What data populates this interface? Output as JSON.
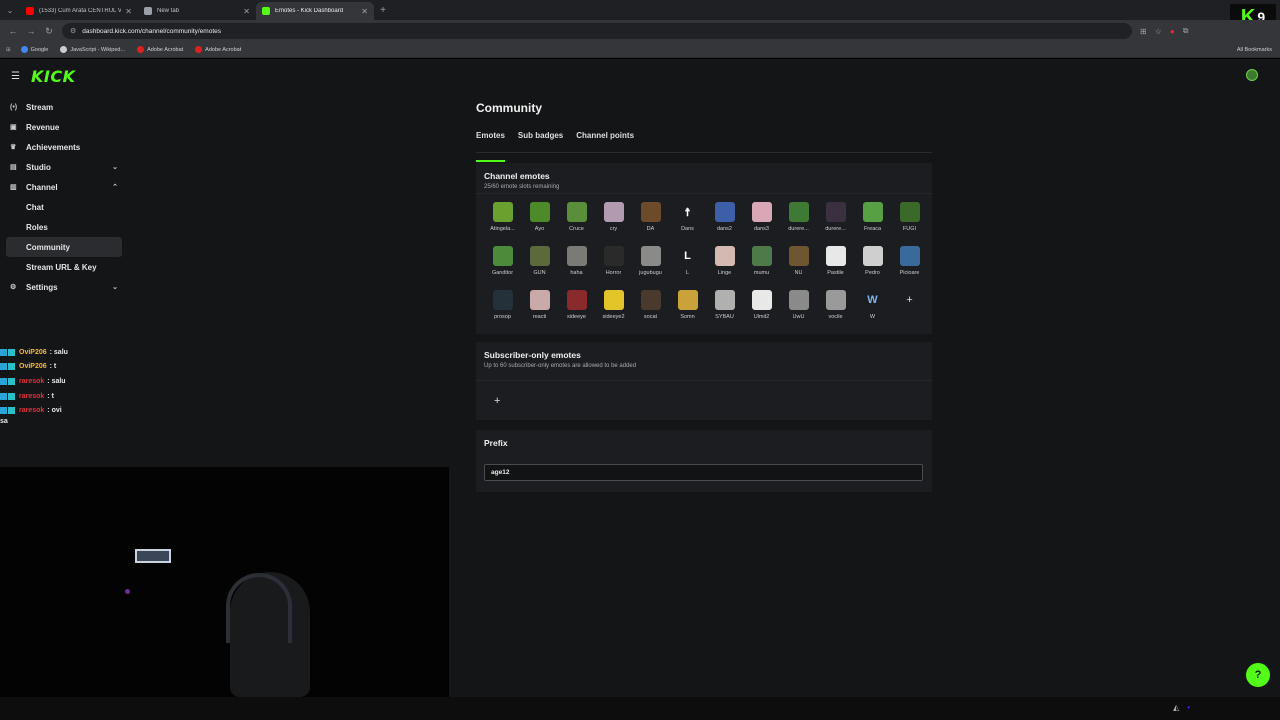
{
  "browser": {
    "tabs": [
      {
        "title": "(1533) Cum Arata CENTRUL VE",
        "favicon_color": "#ff0000",
        "active": false
      },
      {
        "title": "New tab",
        "favicon_color": "#9aa0a6",
        "active": false
      },
      {
        "title": "Emotes - Kick Dashboard",
        "favicon_color": "#53fc18",
        "active": true
      }
    ],
    "url": "dashboard.kick.com/channel/community/emotes",
    "bookmarks": [
      {
        "label": "Google",
        "color": "#4285f4"
      },
      {
        "label": "JavaScript - Wikiped...",
        "color": "#cccccc"
      },
      {
        "label": "Adobe Acrobat",
        "color": "#e02020"
      },
      {
        "label": "Adobe Acrobat",
        "color": "#e02020"
      }
    ],
    "all_bookmarks": "All Bookmarks",
    "overlay_badge": {
      "letter": "K",
      "number": "9"
    }
  },
  "app": {
    "logo": "KICK",
    "accent": "#53fc18"
  },
  "sidebar": {
    "items": [
      {
        "label": "Stream",
        "icon": "stream-icon",
        "glyph": "(•)",
        "sub": false,
        "active": false,
        "chevron": ""
      },
      {
        "label": "Revenue",
        "icon": "revenue-icon",
        "glyph": "▣",
        "sub": false,
        "active": false,
        "chevron": ""
      },
      {
        "label": "Achievements",
        "icon": "trophy-icon",
        "glyph": "♛",
        "sub": false,
        "active": false,
        "chevron": ""
      },
      {
        "label": "Studio",
        "icon": "studio-icon",
        "glyph": "▤",
        "sub": false,
        "active": false,
        "chevron": "⌄"
      },
      {
        "label": "Channel",
        "icon": "channel-icon",
        "glyph": "▥",
        "sub": false,
        "active": false,
        "chevron": "⌃"
      },
      {
        "label": "Chat",
        "icon": "",
        "glyph": "",
        "sub": true,
        "active": false,
        "chevron": ""
      },
      {
        "label": "Roles",
        "icon": "",
        "glyph": "",
        "sub": true,
        "active": false,
        "chevron": ""
      },
      {
        "label": "Community",
        "icon": "",
        "glyph": "",
        "sub": true,
        "active": true,
        "chevron": ""
      },
      {
        "label": "Stream URL & Key",
        "icon": "",
        "glyph": "",
        "sub": true,
        "active": false,
        "chevron": ""
      },
      {
        "label": "Settings",
        "icon": "gear-icon",
        "glyph": "⚙",
        "sub": false,
        "active": false,
        "chevron": "⌄"
      }
    ]
  },
  "chat_overlay": {
    "lines": [
      {
        "user": "OviP206",
        "color": "#f5b93a",
        "text": ": salu"
      },
      {
        "user": "OviP206",
        "color": "#f5b93a",
        "text": ": t"
      },
      {
        "user": "raresok",
        "color": "#e0323c",
        "text": ": salu"
      },
      {
        "user": "raresok",
        "color": "#e0323c",
        "text": ": t"
      },
      {
        "user": "raresok",
        "color": "#e0323c",
        "text": ": ovi"
      }
    ],
    "tail": "sa"
  },
  "community": {
    "title": "Community",
    "tabs": [
      {
        "label": "Emotes",
        "active": true
      },
      {
        "label": "Sub badges",
        "active": false
      },
      {
        "label": "Channel points",
        "active": false
      }
    ],
    "channel_emotes": {
      "title": "Channel emotes",
      "subtitle": "25/60 emote slots remaining",
      "emotes": [
        {
          "name": "Atingela...",
          "color": "#6aa12e",
          "glyph": ""
        },
        {
          "name": "Ayo",
          "color": "#4c8a2c",
          "glyph": ""
        },
        {
          "name": "Cruce",
          "color": "#5a8f3a",
          "glyph": ""
        },
        {
          "name": "cry",
          "color": "#b29ab0",
          "glyph": ""
        },
        {
          "name": "DA",
          "color": "#6d4a2a",
          "glyph": ""
        },
        {
          "name": "Dans",
          "color": "#1c1d20",
          "glyph": "☨"
        },
        {
          "name": "dans2",
          "color": "#3d5ea8",
          "glyph": ""
        },
        {
          "name": "dans3",
          "color": "#d9a7b6",
          "glyph": ""
        },
        {
          "name": "durere...",
          "color": "#3f7a35",
          "glyph": ""
        },
        {
          "name": "durere...",
          "color": "#3a3040",
          "glyph": ""
        },
        {
          "name": "Freaca",
          "color": "#57a043",
          "glyph": ""
        },
        {
          "name": "FUGI",
          "color": "#3a6a2a",
          "glyph": ""
        },
        {
          "name": "Ganditor",
          "color": "#4b8b3a",
          "glyph": ""
        },
        {
          "name": "GUN",
          "color": "#5b6a3a",
          "glyph": ""
        },
        {
          "name": "haha",
          "color": "#7a7a76",
          "glyph": ""
        },
        {
          "name": "Horror",
          "color": "#2a2a2a",
          "glyph": ""
        },
        {
          "name": "jugubugu",
          "color": "#8a8a88",
          "glyph": ""
        },
        {
          "name": "L",
          "color": "#1c1d20",
          "glyph": "L"
        },
        {
          "name": "Linge",
          "color": "#d4b8b2",
          "glyph": ""
        },
        {
          "name": "mumu",
          "color": "#4e7a4a",
          "glyph": ""
        },
        {
          "name": "NU",
          "color": "#6e5630",
          "glyph": ""
        },
        {
          "name": "Pastile",
          "color": "#e8e8e8",
          "glyph": ""
        },
        {
          "name": "Pedro",
          "color": "#cfcfcf",
          "glyph": ""
        },
        {
          "name": "Picioare",
          "color": "#3a6a9a",
          "glyph": ""
        },
        {
          "name": "prosop",
          "color": "#24313a",
          "glyph": ""
        },
        {
          "name": "reacti",
          "color": "#c9aaa8",
          "glyph": ""
        },
        {
          "name": "sideeye",
          "color": "#8a2a2a",
          "glyph": ""
        },
        {
          "name": "sideeye2",
          "color": "#e3c52a",
          "glyph": ""
        },
        {
          "name": "socat",
          "color": "#4a3a2e",
          "glyph": ""
        },
        {
          "name": "Somn",
          "color": "#c9a23a",
          "glyph": ""
        },
        {
          "name": "SYBAU",
          "color": "#b0b0b0",
          "glyph": ""
        },
        {
          "name": "Ulmit2",
          "color": "#e8e8e8",
          "glyph": ""
        },
        {
          "name": "UwU",
          "color": "#8a8a8a",
          "glyph": ""
        },
        {
          "name": "vocile",
          "color": "#9a9a9a",
          "glyph": ""
        },
        {
          "name": "W",
          "color": "#1c1d20",
          "glyph": "W"
        }
      ],
      "add_glyph": "+"
    },
    "subscriber_emotes": {
      "title": "Subscriber-only emotes",
      "subtitle": "Up to 60 subscriber-only emotes are allowed to be added",
      "add_glyph": "+"
    },
    "prefix": {
      "title": "Prefix",
      "value": "age12"
    }
  }
}
